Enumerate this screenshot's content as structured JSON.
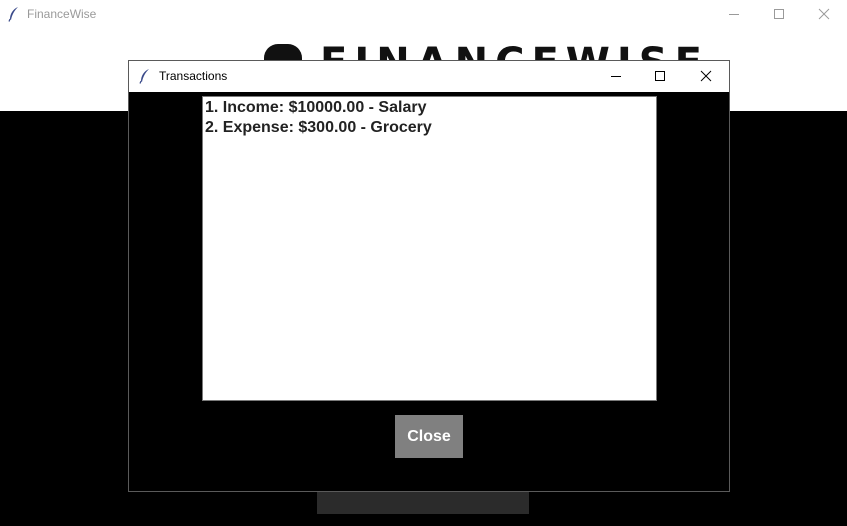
{
  "main_window": {
    "title": "FinanceWise",
    "icon": "feather-icon",
    "logo_text": "FINANCEWISE",
    "controls": [
      "minimize-icon",
      "maximize-icon",
      "close-icon"
    ]
  },
  "dialog": {
    "title": "Transactions",
    "icon": "feather-icon",
    "controls": [
      "minimize-icon",
      "maximize-icon",
      "close-icon"
    ],
    "transactions": [
      "1. Income: $10000.00 - Salary",
      "2. Expense: $300.00 - Grocery"
    ],
    "close_label": "Close"
  },
  "colors": {
    "background": "#000000",
    "titlebar": "#ffffff",
    "button": "#808080",
    "button_text": "#ffffff"
  }
}
